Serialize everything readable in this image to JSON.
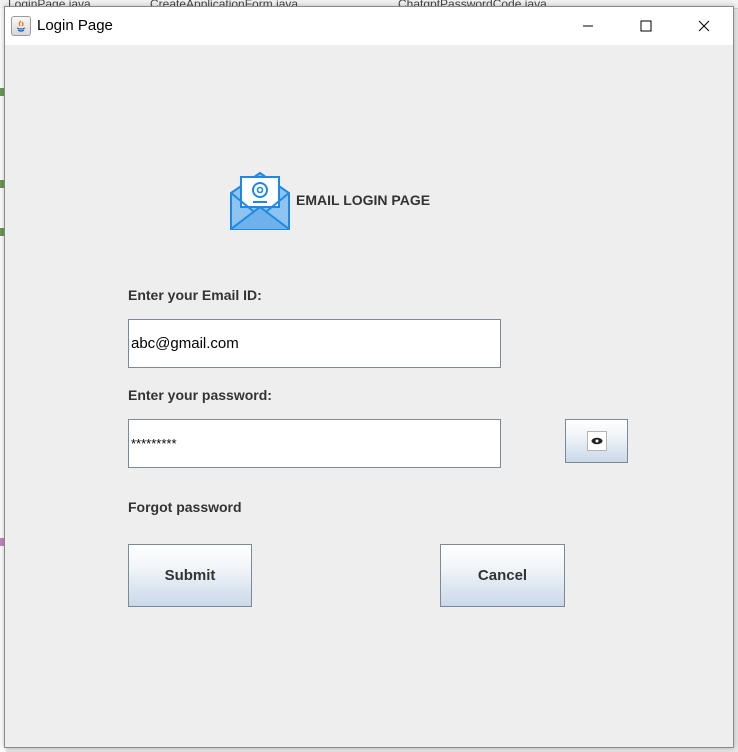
{
  "window": {
    "title": "Login Page"
  },
  "background_tabs": [
    {
      "label": "LoginPage.java"
    },
    {
      "label": "CreateApplicationForm.java"
    },
    {
      "label": "ChatgptPasswordCode.java"
    }
  ],
  "header": {
    "title": "EMAIL LOGIN PAGE"
  },
  "email": {
    "label": "Enter your Email ID:",
    "value": "abc@gmail.com"
  },
  "password": {
    "label": "Enter your password:",
    "value": "*********"
  },
  "forgot": {
    "label": "Forgot password"
  },
  "buttons": {
    "submit": "Submit",
    "cancel": "Cancel"
  },
  "colors": {
    "accent_blue": "#1e88e5",
    "window_bg": "#eeeeee"
  }
}
